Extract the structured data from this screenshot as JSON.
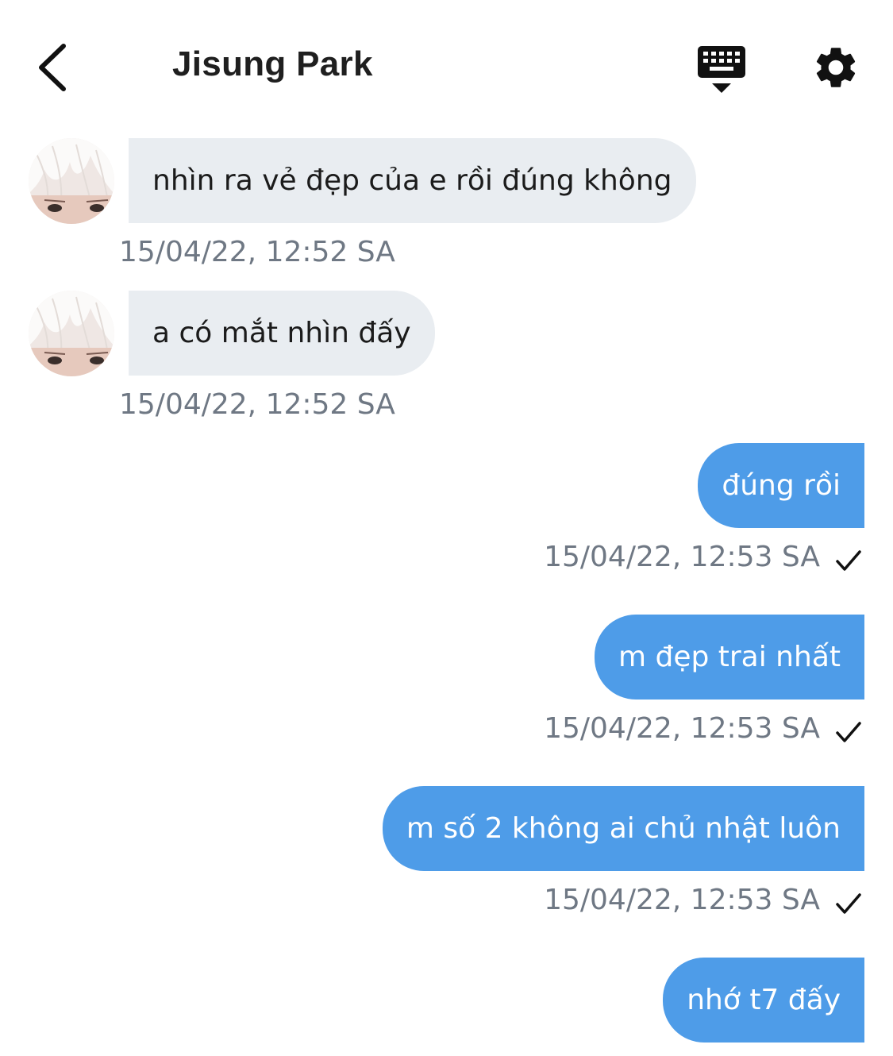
{
  "header": {
    "title": "Jisung Park"
  },
  "messages": [
    {
      "direction": "incoming",
      "text": "nhìn ra vẻ đẹp của e rồi đúng không",
      "time": "15/04/22, 12:52 SA"
    },
    {
      "direction": "incoming",
      "text": "a có mắt nhìn đấy",
      "time": "15/04/22, 12:52 SA"
    },
    {
      "direction": "outgoing",
      "text": "đúng rồi",
      "time": "15/04/22, 12:53 SA",
      "status": "sent"
    },
    {
      "direction": "outgoing",
      "text": "m đẹp trai nhất",
      "time": "15/04/22, 12:53 SA",
      "status": "sent"
    },
    {
      "direction": "outgoing",
      "text": "m số 2 không ai chủ nhật luôn",
      "time": "15/04/22, 12:53 SA",
      "status": "sent"
    },
    {
      "direction": "outgoing",
      "text": "nhớ t7 đấy"
    }
  ],
  "colors": {
    "incoming_bubble": "#e9edf1",
    "outgoing_bubble": "#4e9ce8",
    "timestamp": "#6f7884",
    "icon": "#111111"
  },
  "icons": {
    "back": "chevron-left-icon",
    "keyboard": "keyboard-icon",
    "settings": "gear-icon",
    "read_status": "checkmark-icon"
  }
}
